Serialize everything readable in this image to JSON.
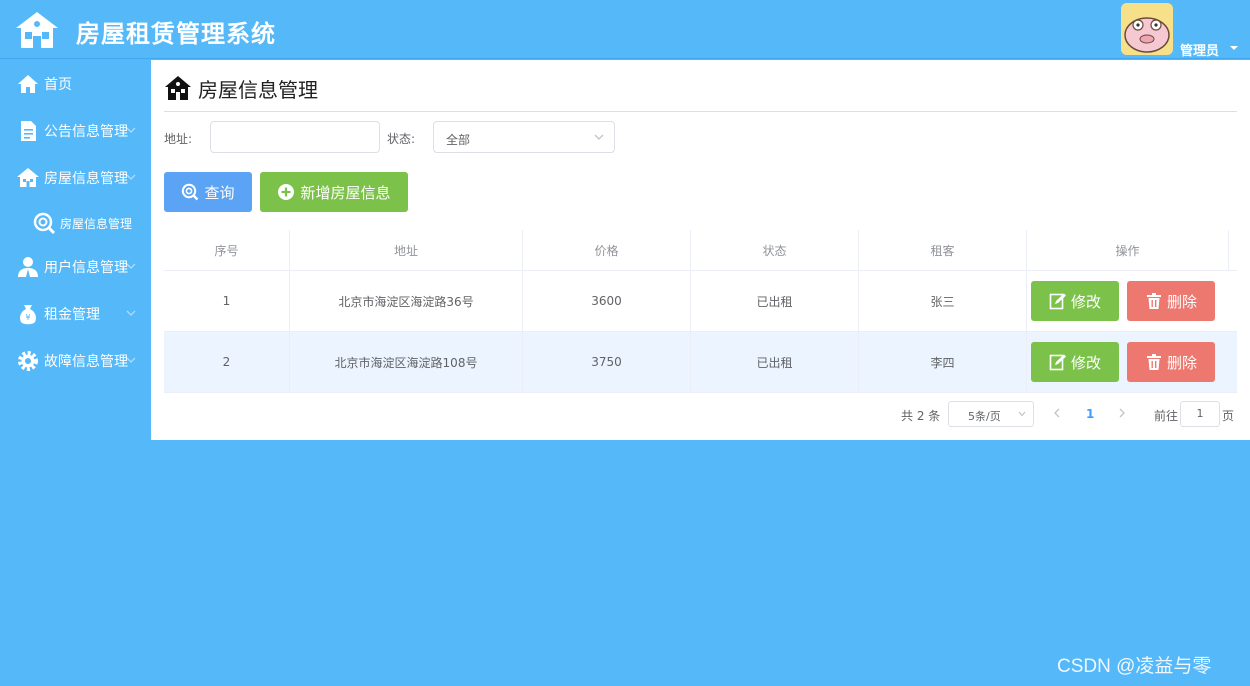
{
  "header": {
    "app_title": "房屋租赁管理系统",
    "user_name": "管理员"
  },
  "sidebar": {
    "items": [
      {
        "label": "首页",
        "icon": "home-icon"
      },
      {
        "label": "公告信息管理",
        "icon": "document-icon"
      },
      {
        "label": "房屋信息管理",
        "icon": "house-icon"
      },
      {
        "label": "房屋信息管理",
        "icon": "search-icon",
        "sub": true
      },
      {
        "label": "用户信息管理",
        "icon": "user-icon"
      },
      {
        "label": "租金管理",
        "icon": "money-bag-icon"
      },
      {
        "label": "故障信息管理",
        "icon": "gear-icon"
      }
    ]
  },
  "main": {
    "page_title": "房屋信息管理",
    "filters": {
      "address_label": "地址:",
      "address_value": "",
      "status_label": "状态:",
      "status_value": "全部"
    },
    "buttons": {
      "query": "查询",
      "add": "新增房屋信息"
    },
    "table": {
      "columns": [
        "序号",
        "地址",
        "价格",
        "状态",
        "租客",
        "操作"
      ],
      "rows": [
        {
          "index": "1",
          "address": "北京市海淀区海淀路36号",
          "price": "3600",
          "status": "已出租",
          "tenant": "张三"
        },
        {
          "index": "2",
          "address": "北京市海淀区海淀路108号",
          "price": "3750",
          "status": "已出租",
          "tenant": "李四"
        }
      ],
      "edit_label": "修改",
      "delete_label": "删除"
    },
    "pagination": {
      "total": "共 2 条",
      "page_size": "5条/页",
      "current_page": "1",
      "goto_label": "前往",
      "goto_value": "1",
      "page_unit": "页"
    }
  },
  "watermark": "CSDN @凌益与零",
  "colors": {
    "background": "#55b8f9",
    "primary": "#5ba3f4",
    "success": "#7cc24a",
    "danger": "#ec7870",
    "row_highlight": "#ecf5ff"
  }
}
